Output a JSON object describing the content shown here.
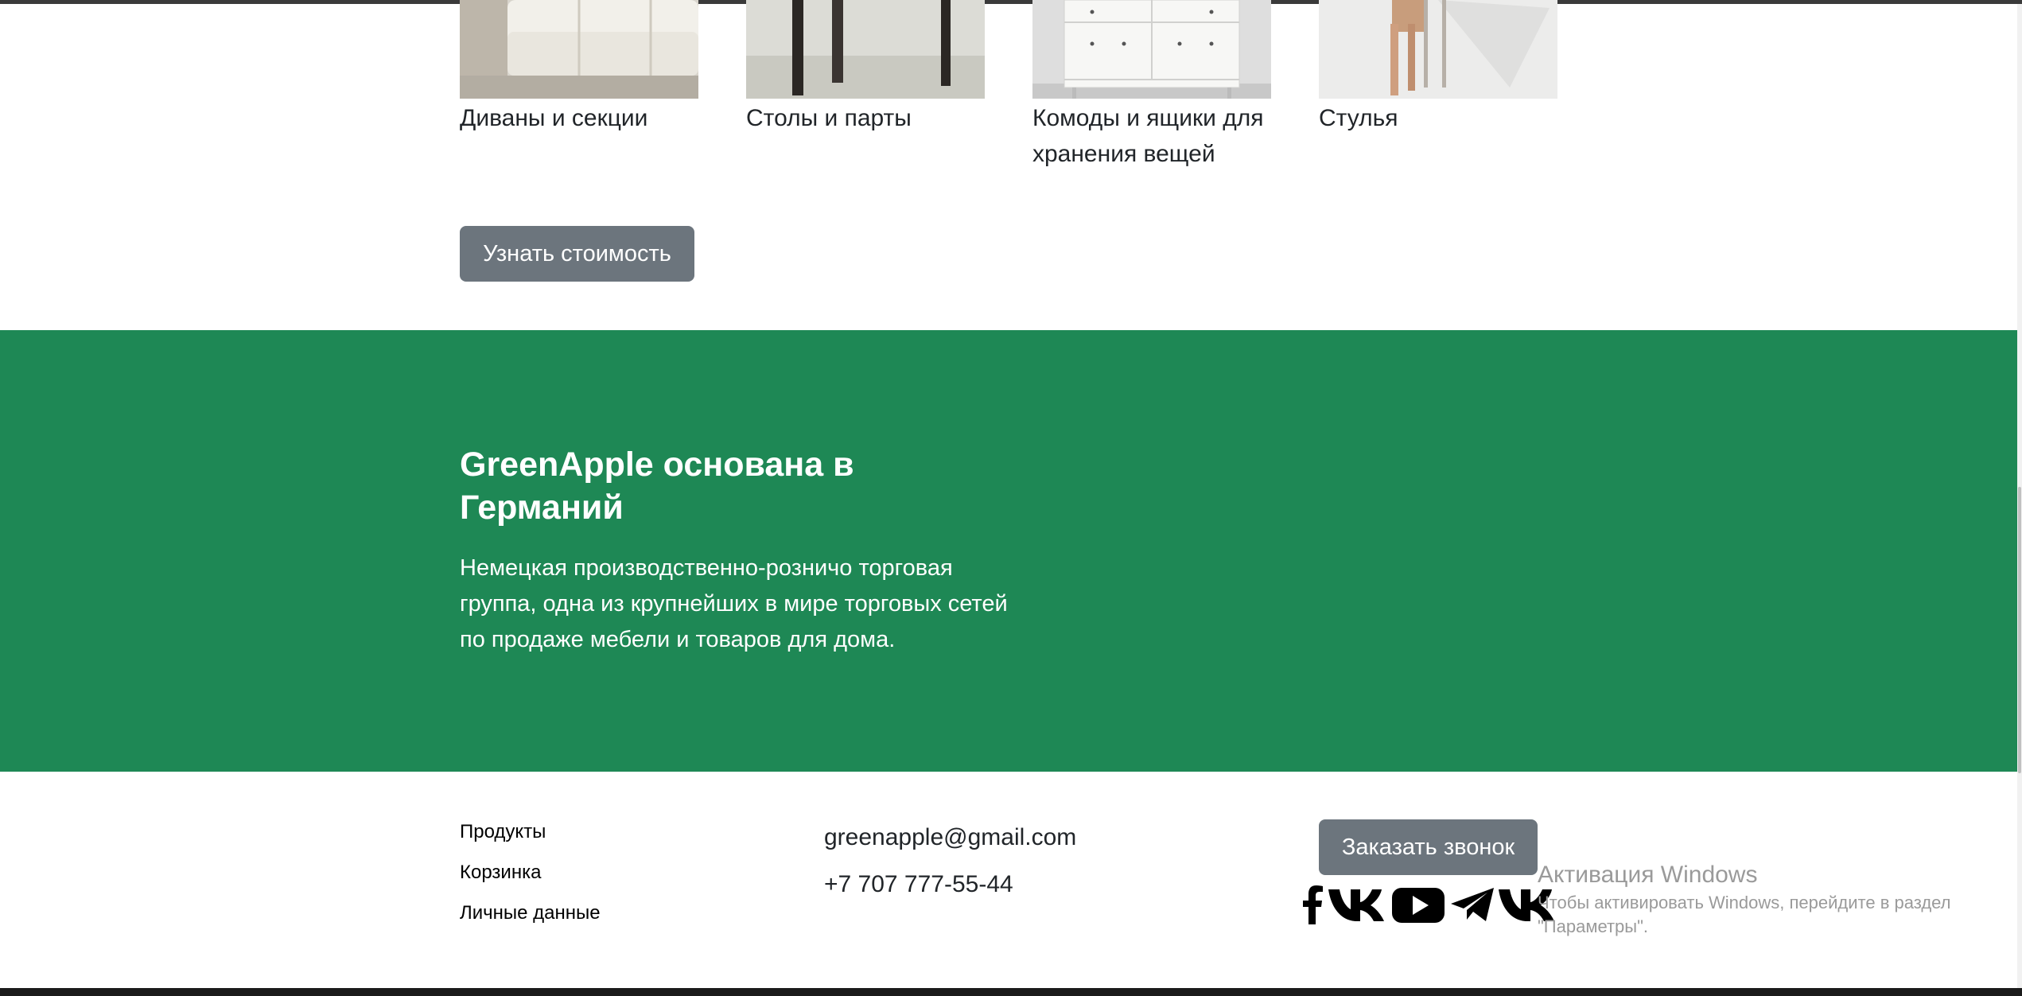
{
  "products": [
    {
      "name": "Диваны и секции",
      "image": "sofa"
    },
    {
      "name": "Столы и парты",
      "image": "table"
    },
    {
      "name": "Комоды и ящики для хранения вещей",
      "image": "drawer-chest"
    },
    {
      "name": "Стулья",
      "image": "chair"
    }
  ],
  "cta": {
    "price_button": "Узнать стоимость"
  },
  "about": {
    "title": "GreenApple основана в Германий",
    "text": "Немецкая производственно-розничо торговая группа, одна из крупнейших в мире торговых сетей по продаже мебели и товаров для дома."
  },
  "footer": {
    "links": [
      "Продукты",
      "Корзинка",
      "Личные данные"
    ],
    "email": "greenapple@gmail.com",
    "phone": "+7 707 777-55-44",
    "callback_button": "Заказать звонок",
    "socials": [
      "facebook-icon",
      "vk-icon",
      "youtube-icon",
      "telegram-icon",
      "vk-icon"
    ]
  },
  "windows_activation": {
    "title": "Активация Windows",
    "line1": "Чтобы активировать Windows, перейдите в раздел",
    "line2": "\"Параметры\"."
  },
  "colors": {
    "accent_green": "#1e8855",
    "button_gray": "#6c757d"
  }
}
